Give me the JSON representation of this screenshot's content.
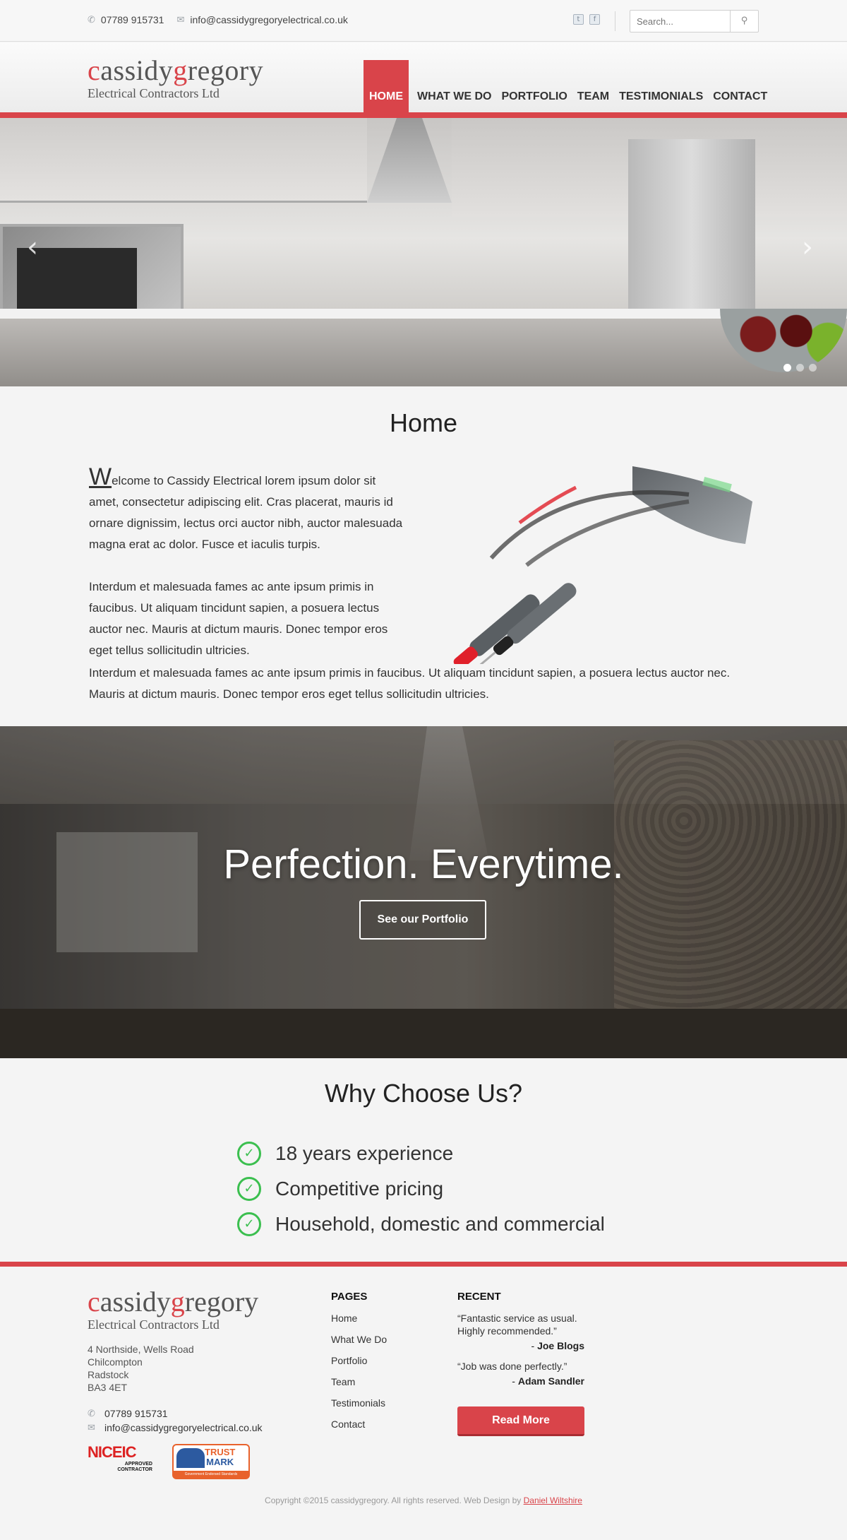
{
  "topbar": {
    "phone": "07789 915731",
    "email": "info@cassidygregoryelectrical.co.uk",
    "search_placeholder": "Search...",
    "icons": [
      "phone-icon",
      "mail-icon",
      "twitter-icon",
      "facebook-icon",
      "binoculars-icon"
    ]
  },
  "brand": {
    "name_first_letter": "c",
    "name_part1": "assidy",
    "name_second_letter": "g",
    "name_part2": "regory",
    "subtitle": "Electrical Contractors Ltd",
    "accent_color": "#d9444a"
  },
  "nav": {
    "items": [
      "HOME",
      "WHAT WE DO",
      "PORTFOLIO",
      "TEAM",
      "TESTIMONIALS",
      "CONTACT"
    ],
    "active": "HOME"
  },
  "slider": {
    "slide_count": 3,
    "active_slide": 1,
    "prev_icon": "chevron-left-icon",
    "next_icon": "chevron-right-icon"
  },
  "home": {
    "title": "Home",
    "drop_cap": "W",
    "para1_rest": "elcome to Cassidy Electrical lorem ipsum dolor sit amet, consectetur adipiscing elit. Cras placerat, mauris id ornare dignissim, lectus orci auctor nibh, auctor malesuada magna erat ac dolor.  Fusce et iaculis turpis.",
    "para2": "Interdum et malesuada fames ac ante ipsum primis in faucibus.  Ut aliquam tincidunt sapien, a posuera lectus auctor nec.  Mauris at dictum mauris.  Donec tempor eros eget tellus sollicitudin ultricies.",
    "para3": "Interdum et malesuada fames ac ante ipsum primis in faucibus.  Ut aliquam tincidunt sapien, a posuera lectus auctor nec.  Mauris at dictum mauris.  Donec tempor eros eget tellus sollicitudin ultricies."
  },
  "banner": {
    "title": "Perfection. Everytime.",
    "button": "See our Portfolio"
  },
  "why": {
    "title": "Why Choose Us?",
    "items": [
      "18 years experience",
      "Competitive pricing",
      "Household, domestic and commercial"
    ],
    "check_color": "#3bbf4f"
  },
  "footer": {
    "address": [
      "4 Northside, Wells Road",
      "Chilcompton",
      "Radstock",
      "BA3 4ET"
    ],
    "phone": "07789 915731",
    "email": "info@cassidygregoryelectrical.co.uk",
    "niceic": {
      "logo": "NICEIC",
      "line1": "APPROVED",
      "line2": "CONTRACTOR"
    },
    "trustmark": {
      "line1": "TRUST",
      "line2": "MARK",
      "line3": "Government Endorsed Standards"
    },
    "pages_title": "PAGES",
    "pages": [
      "Home",
      "What We Do",
      "Portfolio",
      "Team",
      "Testimonials",
      "Contact"
    ],
    "recent_title": "RECENT",
    "testimonials": [
      {
        "quote": "“Fantastic service as usual.  Highly recommended.”",
        "author": "Joe Blogs"
      },
      {
        "quote": "“Job was done perfectly.”",
        "author": "Adam Sandler"
      }
    ],
    "read_more": "Read More",
    "copyright": "Copyright ©2015 cassidygregory.  All rights reserved.  Web Design by",
    "designer": "Daniel Wiltshire"
  }
}
